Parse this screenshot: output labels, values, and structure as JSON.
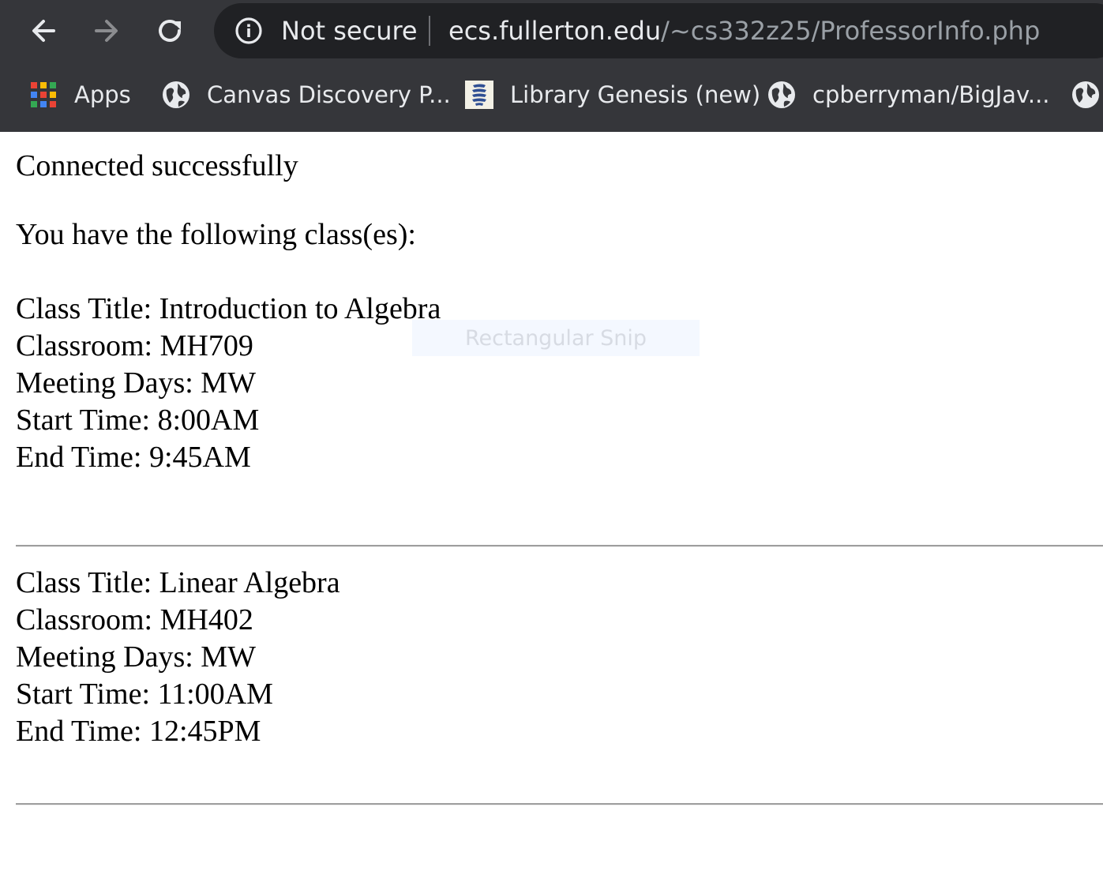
{
  "browser": {
    "toolbar": {
      "back_icon": "arrow-left-icon",
      "forward_icon": "arrow-right-icon",
      "reload_icon": "reload-icon"
    },
    "omnibox": {
      "security_icon": "info-circle-icon",
      "security_label": "Not secure",
      "url_host": "ecs.fullerton.edu",
      "url_path": "/~cs332z25/ProfessorInfo.php"
    },
    "bookmarks": [
      {
        "label": "Apps",
        "icon": "apps-grid-icon"
      },
      {
        "label": "Canvas Discovery P...",
        "icon": "globe-icon"
      },
      {
        "label": "Library Genesis (new)",
        "icon": "library-genesis-icon"
      },
      {
        "label": "cpberryman/BigJav...",
        "icon": "globe-icon"
      },
      {
        "label": "",
        "icon": "globe-icon"
      }
    ],
    "colors": {
      "toolbar_bg": "#35363a",
      "omnibox_bg": "#202124",
      "text": "#e8eaed",
      "url_path": "#9aa0a6"
    }
  },
  "page": {
    "status_message": "Connected successfully",
    "intro": "You have the following class(es):",
    "classes": [
      {
        "title": "Class Title: Introduction to Algebra",
        "classroom": "Classroom: MH709",
        "meeting_days": "Meeting Days: MW",
        "start_time": "Start Time: 8:00AM",
        "end_time": "End Time: 9:45AM"
      },
      {
        "title": "Class Title: Linear Algebra",
        "classroom": "Classroom: MH402",
        "meeting_days": "Meeting Days: MW",
        "start_time": "Start Time: 11:00AM",
        "end_time": "End Time: 12:45PM"
      }
    ]
  },
  "overlay": {
    "snip_label": "Rectangular Snip"
  }
}
